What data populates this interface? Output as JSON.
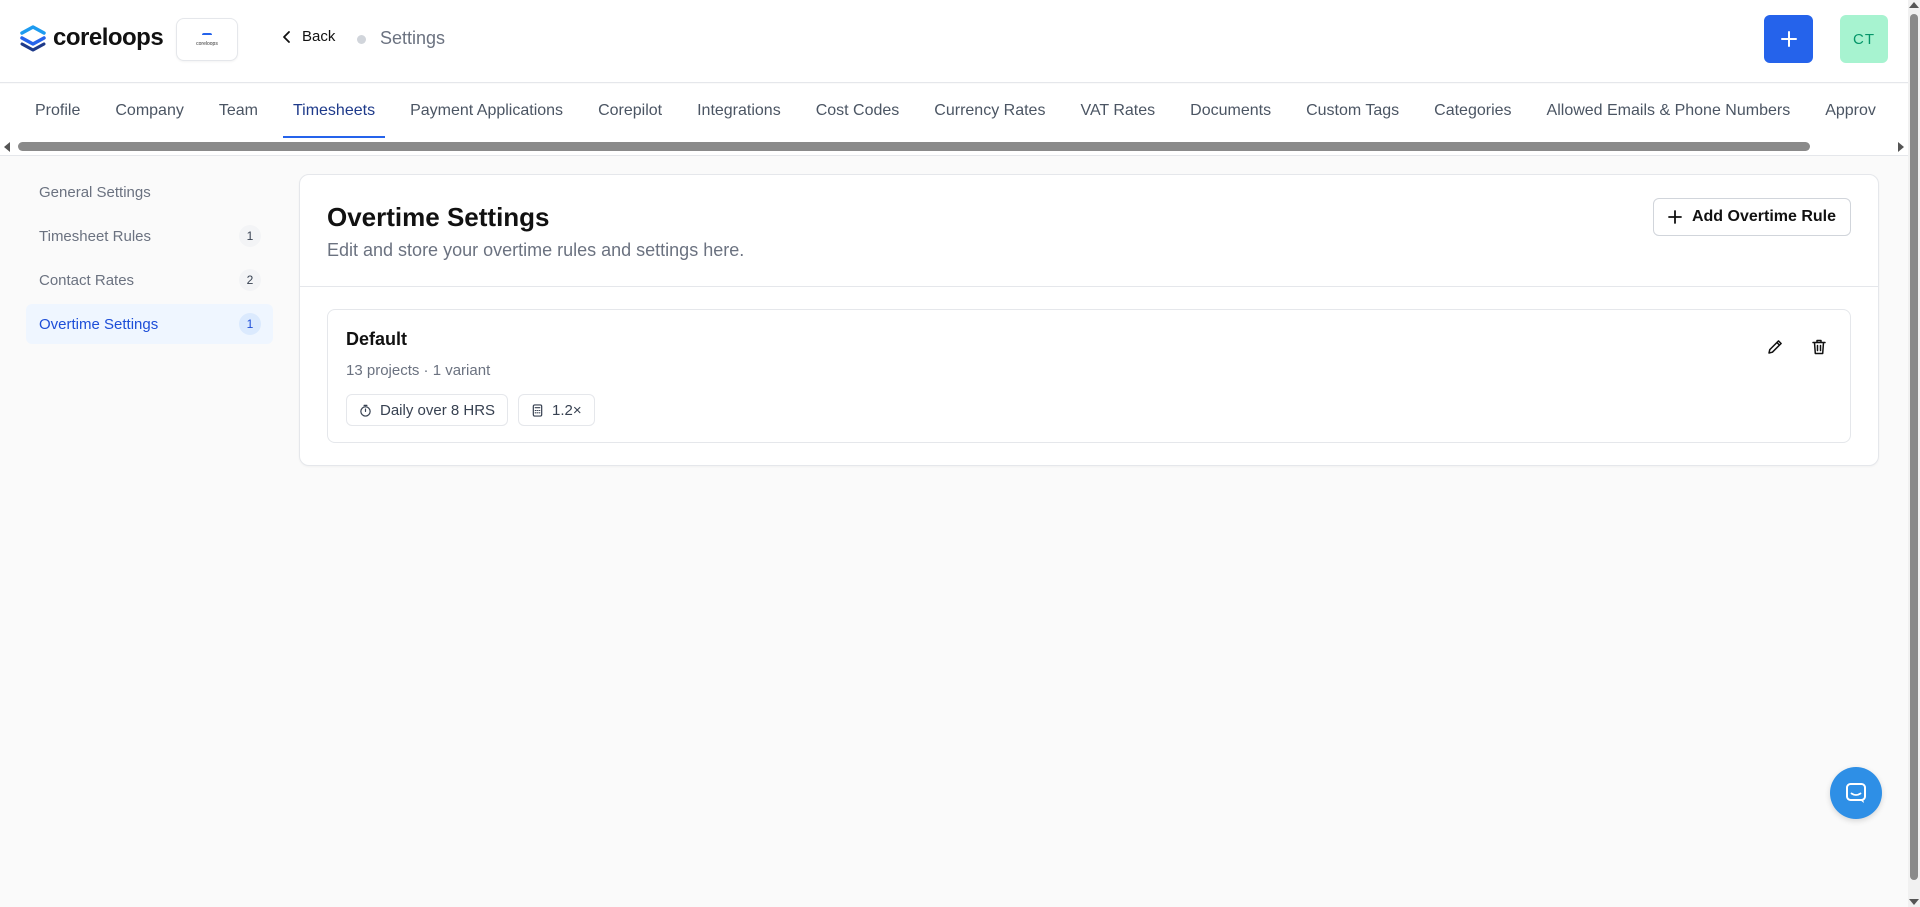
{
  "header": {
    "brand": "coreloops",
    "company_logo_text": "coreloops",
    "back_label": "Back",
    "page_title": "Settings",
    "add_icon": "plus-icon",
    "avatar_initials": "CT"
  },
  "colors": {
    "primary": "#2563eb",
    "avatar_bg": "#a7f3d0",
    "avatar_text": "#059669",
    "chat": "#2e8fe6"
  },
  "tabs": [
    {
      "label": "Profile"
    },
    {
      "label": "Company"
    },
    {
      "label": "Team"
    },
    {
      "label": "Timesheets",
      "active": true
    },
    {
      "label": "Payment Applications"
    },
    {
      "label": "Corepilot"
    },
    {
      "label": "Integrations"
    },
    {
      "label": "Cost Codes"
    },
    {
      "label": "Currency Rates"
    },
    {
      "label": "VAT Rates"
    },
    {
      "label": "Documents"
    },
    {
      "label": "Custom Tags"
    },
    {
      "label": "Categories"
    },
    {
      "label": "Allowed Emails & Phone Numbers"
    },
    {
      "label": "Approv"
    }
  ],
  "sidenav": {
    "items": [
      {
        "label": "General Settings",
        "badge": ""
      },
      {
        "label": "Timesheet Rules",
        "badge": "1"
      },
      {
        "label": "Contact Rates",
        "badge": "2"
      },
      {
        "label": "Overtime Settings",
        "badge": "1",
        "active": true
      }
    ]
  },
  "main": {
    "title": "Overtime Settings",
    "subtitle": "Edit and store your overtime rules and settings here.",
    "add_button_label": "Add Overtime Rule",
    "rules": [
      {
        "name": "Default",
        "meta": "13 projects · 1 variant",
        "chips": [
          {
            "icon": "stopwatch-icon",
            "label": "Daily over 8 HRS"
          },
          {
            "icon": "calculator-icon",
            "label": "1.2×"
          }
        ]
      }
    ]
  }
}
